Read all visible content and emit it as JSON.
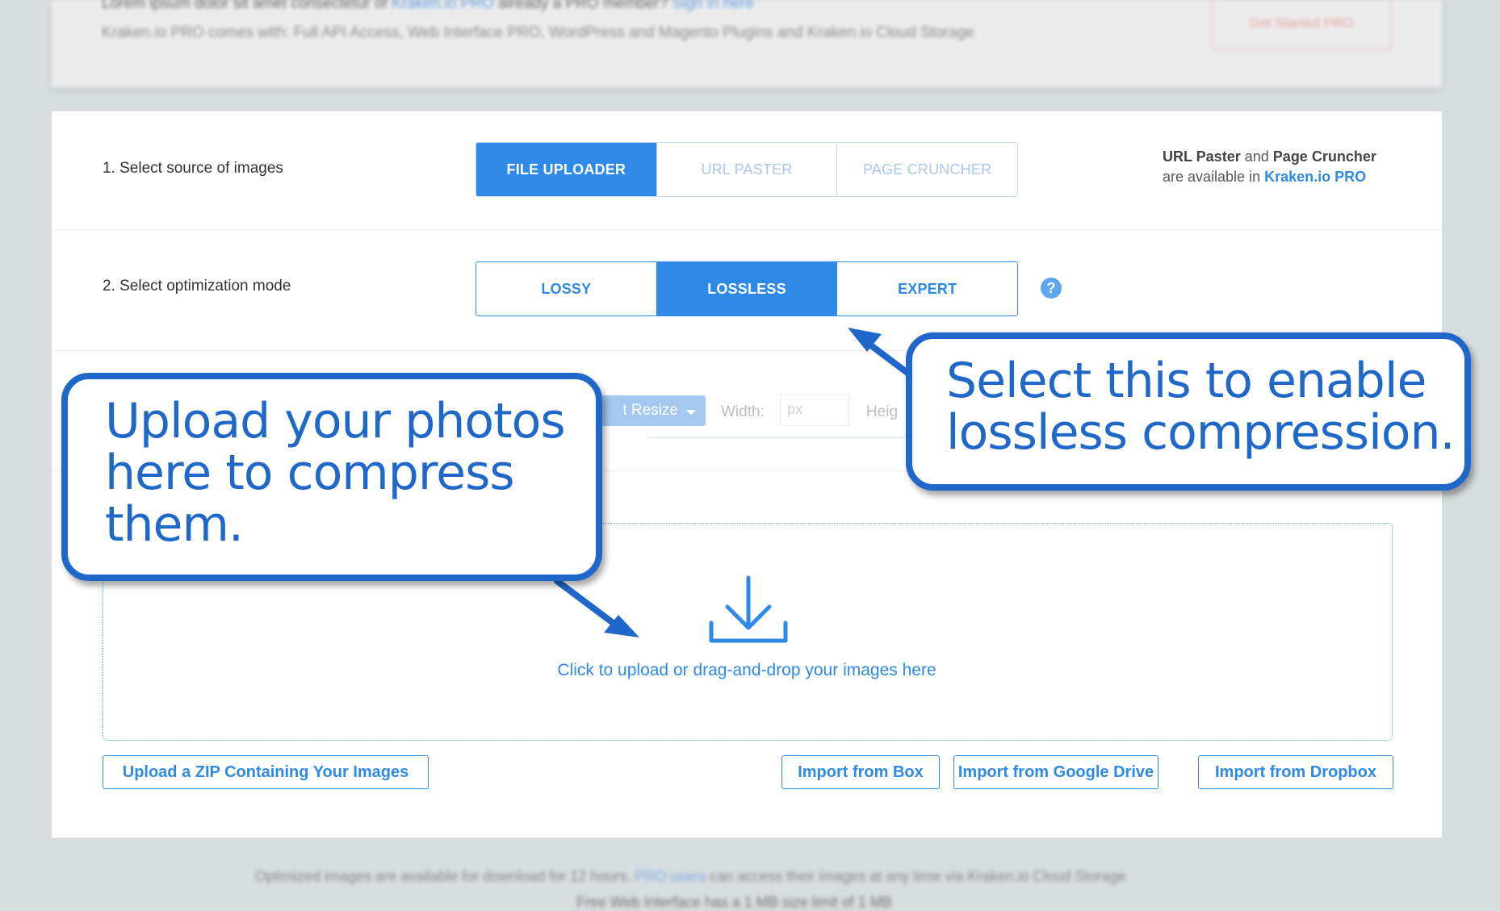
{
  "top_banner": {
    "line1_text": "Lorem ipsum dolor sit amet consectetur of",
    "line1_link": "Kraken.io PRO",
    "line1_suffix": "already a PRO member?",
    "line1_link2": "Sign in here",
    "line2_text": "Kraken.io PRO comes with: Full API Access, Web Interface PRO, WordPress and Magento Plugins and Kraken.io Cloud Storage",
    "button_label": "Get Started PRO"
  },
  "step1": {
    "label": "1. Select source of images",
    "options": [
      {
        "label": "FILE UPLOADER",
        "active": true
      },
      {
        "label": "URL PASTER",
        "active": false
      },
      {
        "label": "PAGE CRUNCHER",
        "active": false
      }
    ],
    "pro_note": {
      "feature1": "URL Paster",
      "and": "and",
      "feature2": "Page Cruncher",
      "prefix2": "are available in",
      "link": "Kraken.io PRO"
    }
  },
  "step2": {
    "label": "2. Select optimization mode",
    "options": [
      {
        "label": "LOSSY",
        "active": false
      },
      {
        "label": "LOSSLESS",
        "active": true
      },
      {
        "label": "EXPERT",
        "active": false
      }
    ],
    "help_icon": "question-icon",
    "help_glyph": "?"
  },
  "resize": {
    "button_label": "t Resize",
    "width_label": "Width:",
    "width_placeholder": "px",
    "height_label": "Heig"
  },
  "dropzone": {
    "icon": "download-icon",
    "text": "Click to upload or drag-and-drop your images here"
  },
  "buttons": {
    "zip": "Upload a ZIP Containing Your Images",
    "box": "Import from Box",
    "gdrive": "Import from Google Drive",
    "dropbox": "Import from Dropbox"
  },
  "footer": {
    "line1_text": "Optimized images are available for download for 12 hours.",
    "line1_link": "PRO users",
    "line1_suffix": "can access their images at any time via Kraken.io Cloud Storage",
    "line2_text": "Free Web Interface has a 1 MB size limit of 1 MB"
  },
  "callouts": {
    "upload_lines": [
      "Upload your photos",
      "here to compress",
      "them."
    ],
    "lossless_lines": [
      "Select this to enable",
      "lossless compression."
    ]
  },
  "colors": {
    "accent": "#2e8ae6",
    "callout": "#1f68c9",
    "background": "#d7dcde"
  }
}
